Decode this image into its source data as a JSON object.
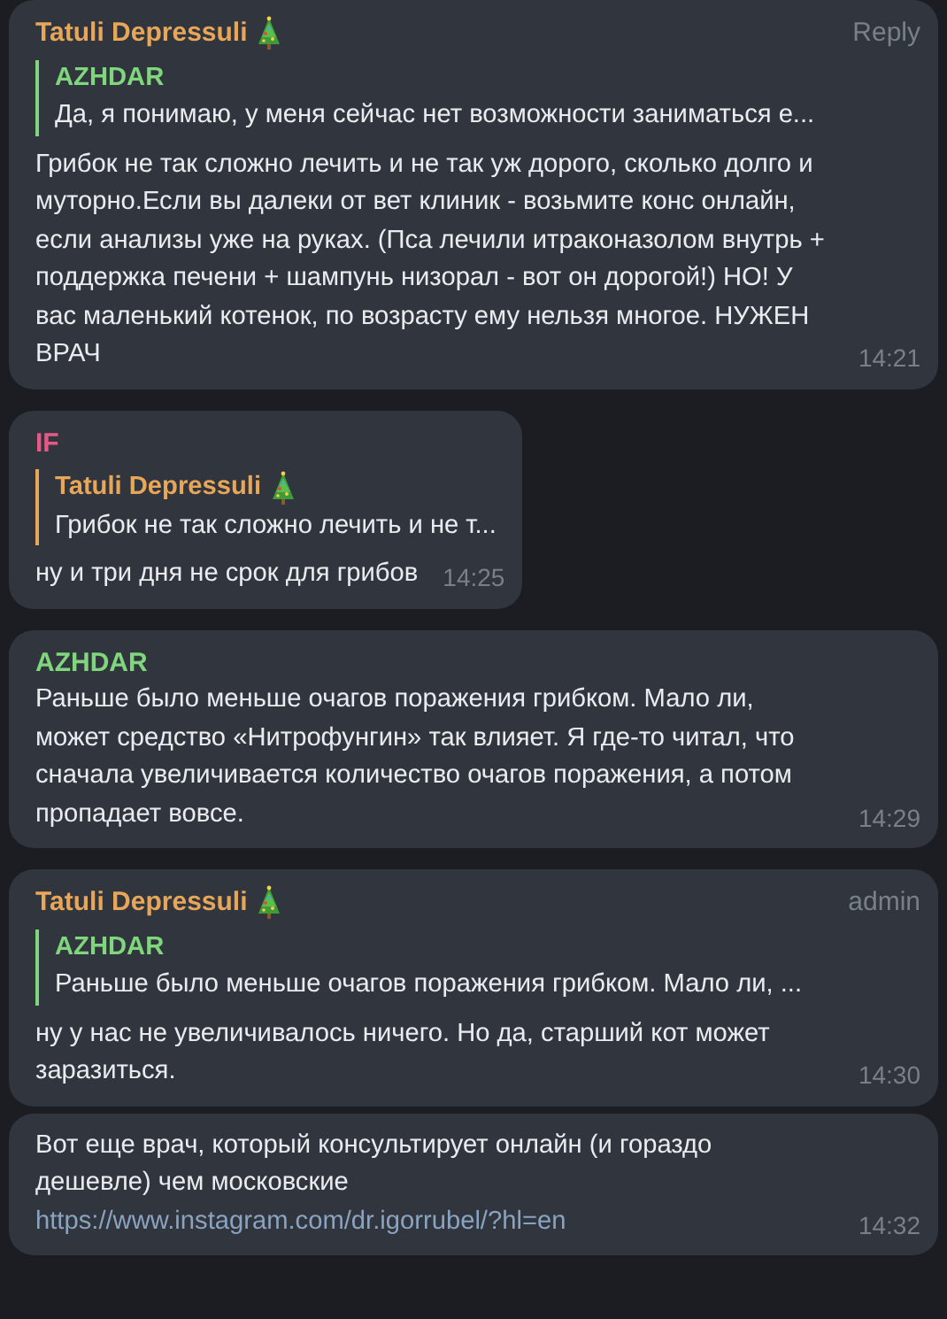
{
  "messages": [
    {
      "author": {
        "name": "Tatuli Depressuli",
        "color": "#e8a659",
        "tree_badge": true
      },
      "tag": "Reply",
      "reply": {
        "author": "AZHDAR",
        "color": "#7fd67c",
        "tree_badge": false,
        "text": "Да, я понимаю, у меня сейчас нет возможности заниматься е..."
      },
      "text": "Грибок не так сложно лечить и не так уж дорого, сколько долго и муторно.Если вы далеки от вет клиник - возьмите конс онлайн, если анализы уже на руках. (Пса лечили итраконазолом внутрь + поддержка печени + шампунь низорал - вот он дорогой!) НО! У вас маленький котенок, по возрасту ему нельзя многое. НУЖЕН ВРАЧ",
      "time": "14:21"
    },
    {
      "author": {
        "name": "IF",
        "color": "#e35a87",
        "tree_badge": false
      },
      "reply": {
        "author": "Tatuli Depressuli",
        "color": "#e8a659",
        "tree_badge": true,
        "text": "Грибок не так сложно лечить и не т..."
      },
      "text": "ну и три дня не срок для грибов",
      "time": "14:25"
    },
    {
      "author": {
        "name": "AZHDAR",
        "color": "#7fd67c",
        "tree_badge": false
      },
      "text": "Раньше было меньше очагов поражения грибком. Мало ли, может средство «Нитрофунгин» так влияет. Я где-то читал, что сначала увеличивается количество очагов поражения, а потом пропадает вовсе.",
      "time": "14:29"
    },
    {
      "author": {
        "name": "Tatuli Depressuli",
        "color": "#e8a659",
        "tree_badge": true
      },
      "tag": "admin",
      "reply": {
        "author": "AZHDAR",
        "color": "#7fd67c",
        "tree_badge": false,
        "text": "Раньше было меньше очагов поражения грибком. Мало ли, ..."
      },
      "text": "ну у нас не увеличивалось ничего. Но да, старший кот может заразиться.",
      "time": "14:30"
    },
    {
      "text": "Вот еще врач, который консультирует онлайн (и гораздо дешевле) чем московские",
      "link": "https://www.instagram.com/dr.igorrubel/?hl=en",
      "time": "14:32"
    }
  ]
}
